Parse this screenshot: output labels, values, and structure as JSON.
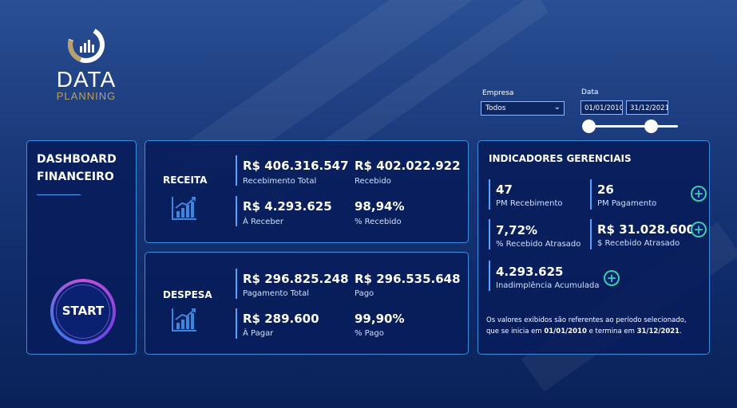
{
  "brand": {
    "line1": "DATA",
    "line2": "PLANNING"
  },
  "filters": {
    "empresa_label": "Empresa",
    "empresa_value": "Todos",
    "data_label": "Data",
    "date_start": "01/01/2010",
    "date_end": "31/12/2021"
  },
  "dashboard": {
    "title_line1": "DASHBOARD",
    "title_line2": "FINANCEIRO",
    "start_label": "START"
  },
  "receita": {
    "title": "RECEITA",
    "m1_value": "R$ 406.316.547",
    "m1_label": "Recebimento Total",
    "m2_value": "R$ 402.022.922",
    "m2_label": "Recebido",
    "m3_value": "R$ 4.293.625",
    "m3_label": "À Receber",
    "m4_value": "98,94%",
    "m4_label": "% Recebido"
  },
  "despesa": {
    "title": "DESPESA",
    "m1_value": "R$ 296.825.248",
    "m1_label": "Pagamento Total",
    "m2_value": "R$ 296.535.648",
    "m2_label": "Pago",
    "m3_value": "R$ 289.600",
    "m3_label": "À Pagar",
    "m4_value": "99,90%",
    "m4_label": "% Pago"
  },
  "indicadores": {
    "title": "INDICADORES GERENCIAIS",
    "i1_value": "47",
    "i1_label": "PM Recebimento",
    "i2_value": "26",
    "i2_label": "PM Pagamento",
    "i3_value": "7,72%",
    "i3_label": "% Recebido Atrasado",
    "i4_value": "R$ 31.028.600",
    "i4_label": "$ Recebido Atrasado",
    "i5_value": "4.293.625",
    "i5_label": "Inadimplência Acumulada",
    "note_pre": "Os valores exibidos são referentes ao período selecionado, que se inicia em ",
    "note_start": "01/01/2010",
    "note_mid": " e termina em ",
    "note_end": "31/12/2021",
    "note_post": "."
  },
  "icons": {
    "logo": "donut-chart-icon",
    "section": "bar-chart-icon",
    "expand": "plus-circle-icon"
  },
  "colors": {
    "accent": "#3e8ce0",
    "teal": "#3ccfa8",
    "gold": "#b9a06a",
    "card_bg": "#0a1f5c"
  }
}
